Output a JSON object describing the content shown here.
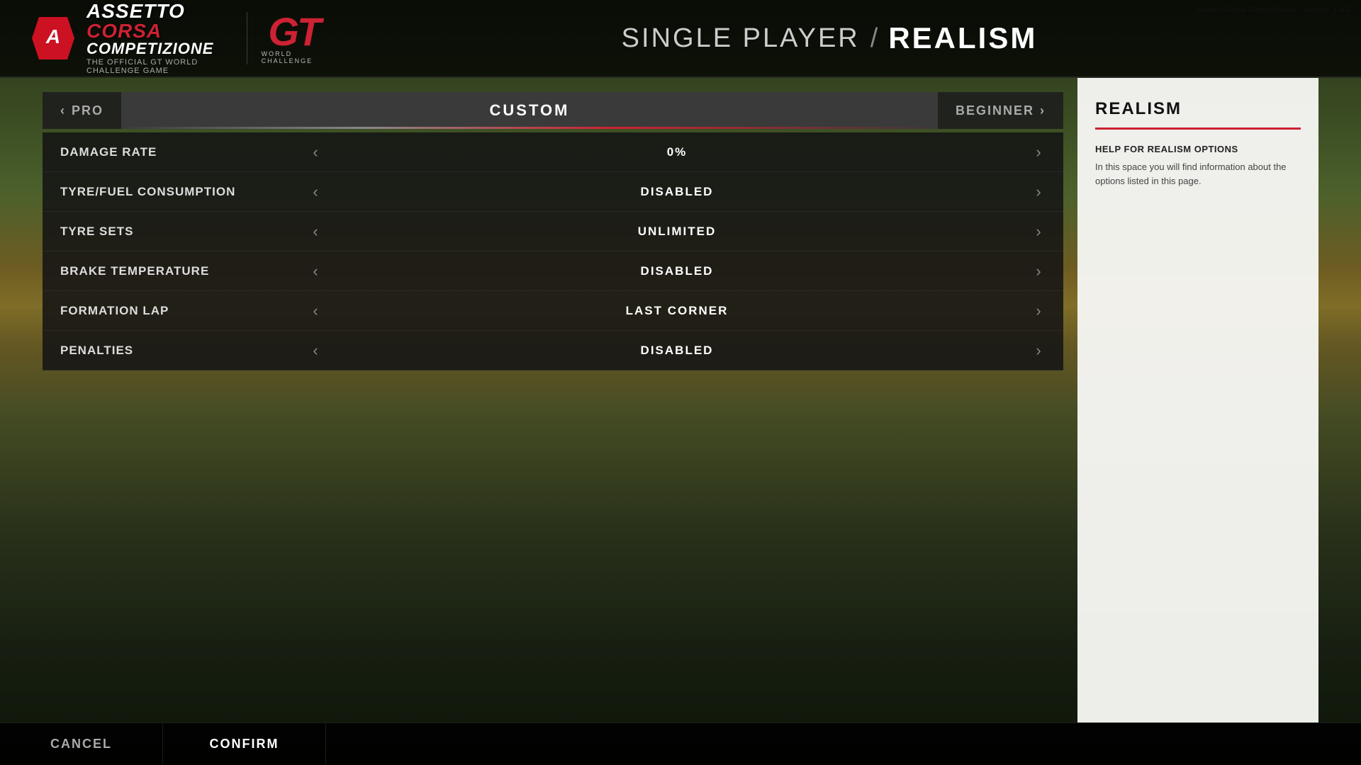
{
  "app": {
    "version": "Assetto Corsa Competizione - Version: 1.4.3",
    "logo_main": "ASSETTO CORSA",
    "logo_sub": "COMPETIZIONE",
    "logo_tagline": "THE OFFICIAL GT WORLD CHALLENGE GAME",
    "gt_label": "GT",
    "world_challenge": "WORLD CHALLENGE"
  },
  "header": {
    "single_player": "SINGLE PLAYER",
    "separator": "/",
    "realism": "REALISM"
  },
  "preset_selector": {
    "pro_label": "PRO",
    "custom_label": "CUSTOM",
    "beginner_label": "BEGINNER",
    "left_chevron": "‹",
    "right_chevron": "›"
  },
  "settings": [
    {
      "label": "DAMAGE RATE",
      "value": "0%"
    },
    {
      "label": "TYRE/FUEL CONSUMPTION",
      "value": "DISABLED"
    },
    {
      "label": "TYRE SETS",
      "value": "UNLIMITED"
    },
    {
      "label": "BRAKE TEMPERATURE",
      "value": "DISABLED"
    },
    {
      "label": "FORMATION LAP",
      "value": "LAST CORNER"
    },
    {
      "label": "PENALTIES",
      "value": "DISABLED"
    }
  ],
  "right_panel": {
    "title": "REALISM",
    "help_title": "HELP FOR REALISM OPTIONS",
    "help_text": "In this space you will find information about the options listed in this page."
  },
  "bottom": {
    "cancel_label": "CANCEL",
    "confirm_label": "CONFIRM"
  },
  "icons": {
    "left_arrow": "‹",
    "right_arrow": "›"
  }
}
